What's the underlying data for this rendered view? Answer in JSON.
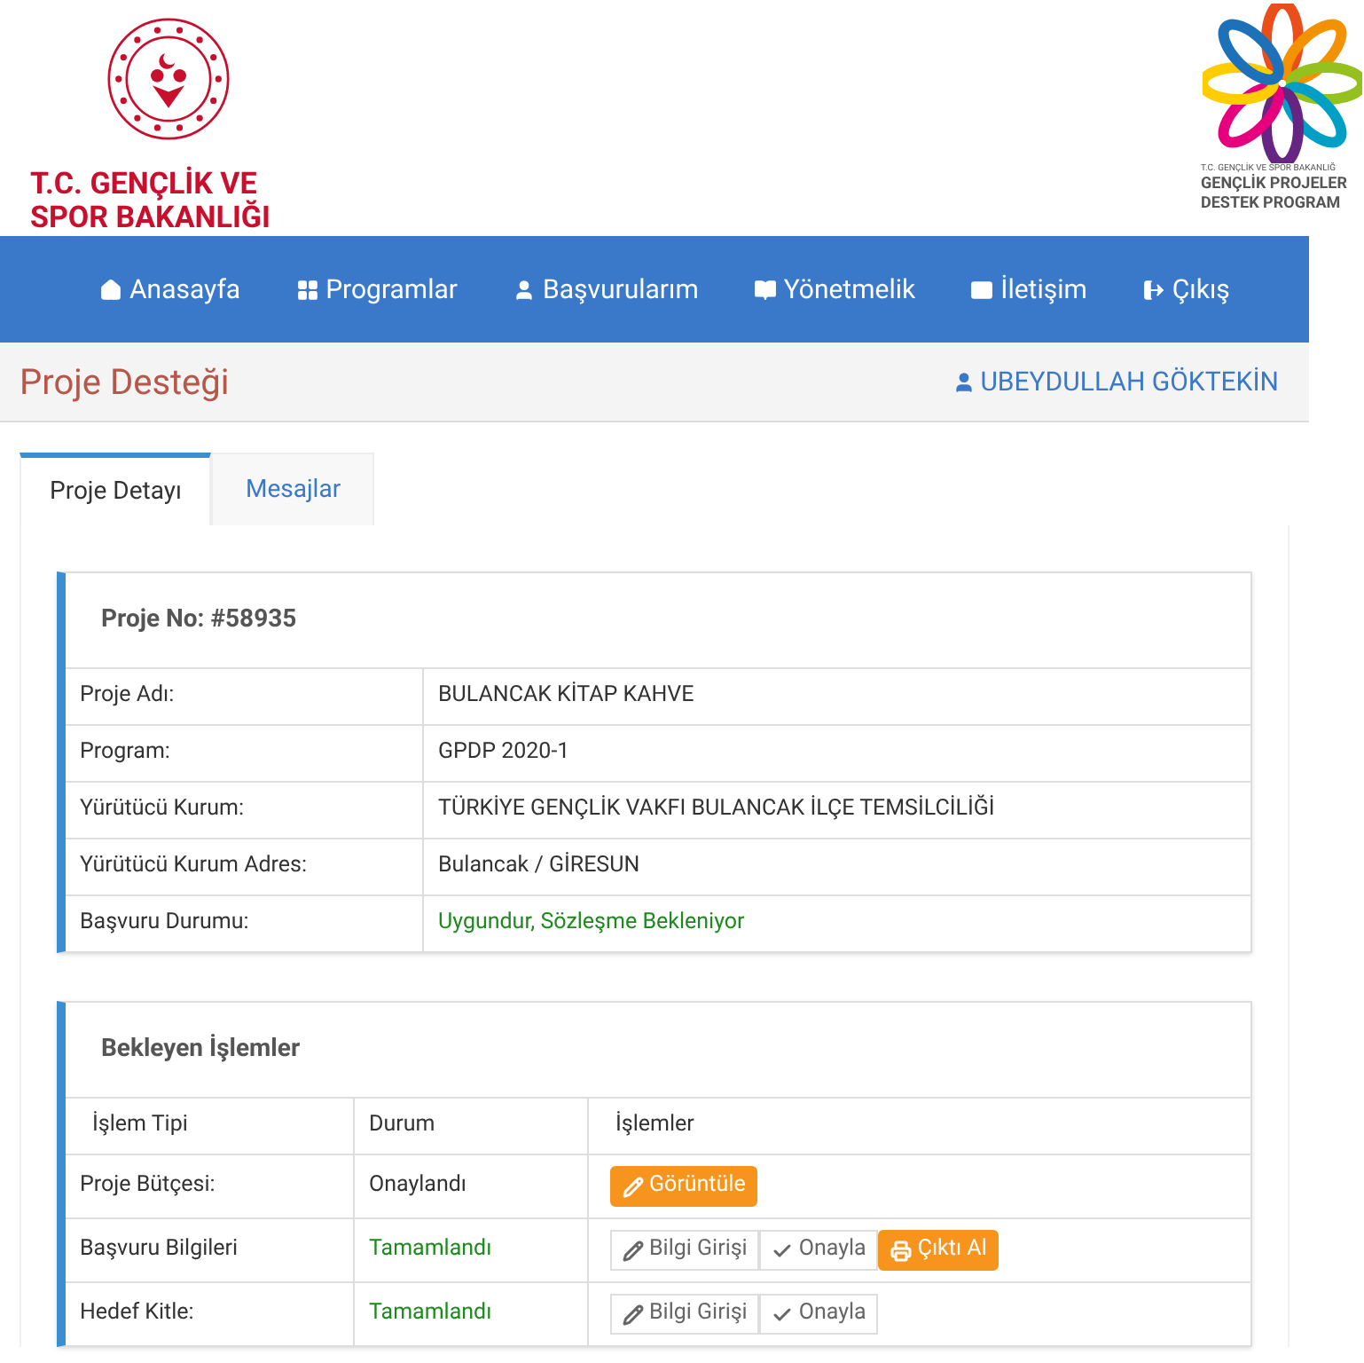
{
  "header": {
    "ministry_logo": [
      "T.C. GENÇLİK VE",
      "SPOR BAKANLIĞI"
    ],
    "program_logo": {
      "caption": "T.C. GENÇLİK VE SPOR BAKANLIĞ",
      "lines": [
        "GENÇLİK PROJELER",
        "DESTEK PROGRAM"
      ]
    }
  },
  "nav": [
    {
      "label": "Anasayfa"
    },
    {
      "label": "Programlar"
    },
    {
      "label": "Başvurularım"
    },
    {
      "label": "Yönetmelik"
    },
    {
      "label": "İletişim"
    },
    {
      "label": "Çıkış"
    }
  ],
  "page_title": "Proje Desteği",
  "user": "UBEYDULLAH GÖKTEKİN",
  "tabs": [
    {
      "label": "Proje Detayı",
      "selected": true
    },
    {
      "label": "Mesajlar",
      "selected": false
    }
  ],
  "project": {
    "title": "Proje No: #58935",
    "rows": [
      {
        "label": "Proje Adı:",
        "value": "BULANCAK KİTAP KAHVE",
        "kind": "plain"
      },
      {
        "label": "Program:",
        "value": "GPDP 2020-1",
        "kind": "plain"
      },
      {
        "label": "Yürütücü Kurum:",
        "value": "TÜRKİYE GENÇLİK VAKFI BULANCAK İLÇE TEMSİLCİLİĞİ",
        "kind": "plain"
      },
      {
        "label": "Yürütücü Kurum Adres:",
        "value": "Bulancak / GİRESUN",
        "kind": "plain"
      },
      {
        "label": "Başvuru Durumu:",
        "value": "Uygundur, Sözleşme Bekleniyor",
        "kind": "success"
      }
    ]
  },
  "pending": {
    "title": "Bekleyen İşlemler",
    "columns": [
      "İşlem Tipi",
      "Durum",
      "İşlemler"
    ],
    "rows": [
      {
        "type": "Proje Bütçesi:",
        "status": "Onaylandı",
        "kind": "plain",
        "actions": [
          {
            "label": "Görüntüle",
            "kind": "view"
          }
        ]
      },
      {
        "type": "Başvuru Bilgileri",
        "status": "Tamamlandı",
        "kind": "success",
        "actions": [
          {
            "label": "Bilgi Girişi",
            "kind": "edit"
          },
          {
            "label": "Onayla",
            "kind": "approve"
          },
          {
            "label": "Çıktı Al",
            "kind": "print"
          }
        ]
      },
      {
        "type": "Hedef Kitle:",
        "status": "Tamamlandı",
        "kind": "success",
        "actions": [
          {
            "label": "Bilgi Girişi",
            "kind": "edit"
          },
          {
            "label": "Onayla",
            "kind": "approve"
          }
        ]
      }
    ]
  }
}
